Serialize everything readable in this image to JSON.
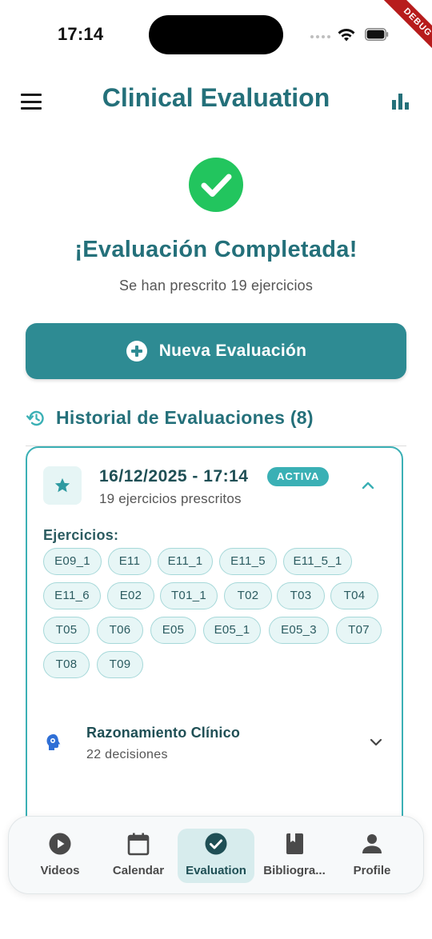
{
  "status_bar": {
    "time": "17:14",
    "debug_label": "DEBUG"
  },
  "app_bar": {
    "title": "Clinical Evaluation",
    "menu_icon": "menu-icon",
    "stats_icon": "bar-chart-icon"
  },
  "completion": {
    "icon": "check-circle-icon",
    "title": "¡Evaluación Completada!",
    "subtitle": "Se han prescrito 19 ejercicios"
  },
  "new_evaluation_button": {
    "label": "Nueva Evaluación",
    "icon": "add-circle-icon"
  },
  "history": {
    "icon": "history-icon",
    "title": "Historial de Evaluaciones (8)",
    "cards": [
      {
        "date": "16/12/2025 - 17:14",
        "badge": "ACTIVA",
        "subtitle": "19 ejercicios prescritos",
        "exercises_label": "Ejercicios:",
        "exercises": [
          "E09_1",
          "E11",
          "E11_1",
          "E11_5",
          "E11_5_1",
          "E11_6",
          "E02",
          "T01_1",
          "T02",
          "T03",
          "T04",
          "T05",
          "T06",
          "E05",
          "E05_1",
          "E05_3",
          "T07",
          "T08",
          "T09"
        ],
        "reasoning_title": "Razonamiento Clínico",
        "reasoning_sub": "22 decisiones"
      }
    ]
  },
  "bottom_nav": {
    "active": "Evaluation",
    "items": [
      {
        "label": "Videos",
        "icon": "play-circle-icon"
      },
      {
        "label": "Calendar",
        "icon": "calendar-icon"
      },
      {
        "label": "Evaluation",
        "icon": "check-circle-icon"
      },
      {
        "label": "Bibliogra...",
        "icon": "book-icon"
      },
      {
        "label": "Profile",
        "icon": "person-icon"
      }
    ]
  },
  "colors": {
    "primary": "#24707a",
    "button": "#2e8b93",
    "accent": "#3ab0b5",
    "success": "#22c55e",
    "chip_bg": "#e7f6f6"
  }
}
